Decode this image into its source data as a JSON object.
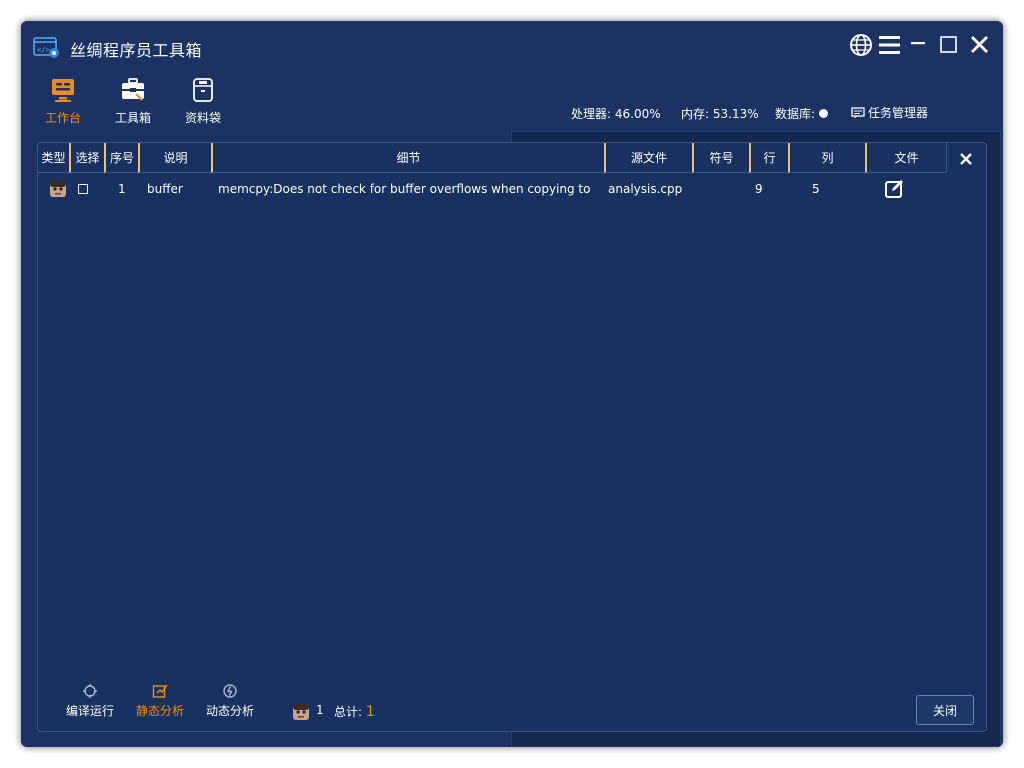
{
  "window": {
    "title": "丝绸程序员工具箱",
    "controls": [
      "language",
      "menu",
      "minimize",
      "maximize",
      "close"
    ]
  },
  "nav": [
    {
      "label": "工作台",
      "icon": "workbench-icon",
      "active": true
    },
    {
      "label": "工具箱",
      "icon": "toolbox-icon",
      "active": false
    },
    {
      "label": "资料袋",
      "icon": "folder-bag-icon",
      "active": false
    }
  ],
  "status": {
    "cpu": "处理器: 46.00%",
    "memory": "内存: 53.13%",
    "database": "数据库:",
    "task_manager": "任务管理器"
  },
  "table": {
    "columns": [
      "类型",
      "选择",
      "序号",
      "说明",
      "细节",
      "源文件",
      "符号",
      "行",
      "列",
      "文件"
    ],
    "rows": [
      {
        "type_icon": "avatar-icon",
        "selected": false,
        "index": "1",
        "description": "buffer",
        "detail": "memcpy:Does not check for buffer overflows when copying to destination",
        "source": "analysis.cpp",
        "symbol": "",
        "line": "9",
        "column": "5",
        "file_icon": "edit-icon"
      }
    ]
  },
  "footer": {
    "tabs": [
      {
        "label": "编译运行",
        "icon": "compile-run-icon",
        "active": false
      },
      {
        "label": "静态分析",
        "icon": "static-analysis-icon",
        "active": true
      },
      {
        "label": "动态分析",
        "icon": "dynamic-analysis-icon",
        "active": false
      }
    ],
    "count": "1",
    "total_label": "总计:",
    "total_value": "1",
    "close_label": "关闭"
  },
  "colors": {
    "background": "#1b3262",
    "accent": "#f08c1c",
    "header_divider": "#f0c070"
  }
}
